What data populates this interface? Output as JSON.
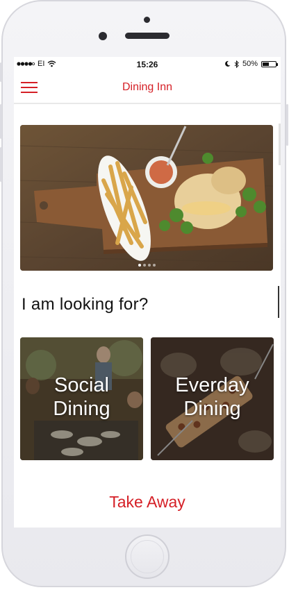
{
  "status_bar": {
    "carrier": "EI",
    "time": "15:26",
    "battery": "50%",
    "battery_level": 0.5
  },
  "navbar": {
    "title": "Dining Inn",
    "menu_icon": "hamburger-menu-icon"
  },
  "carousel": {
    "image": "sandwich-and-fries-on-wooden-board",
    "slide_count": 4,
    "active_slide": 1
  },
  "main": {
    "heading": "I am looking for?",
    "options": [
      {
        "label_line1": "Social",
        "label_line2": "Dining",
        "image": "outdoor-group-meal"
      },
      {
        "label_line1": "Everday",
        "label_line2": "Dining",
        "image": "table-of-dishes"
      }
    ],
    "takeaway_label": "Take Away"
  },
  "colors": {
    "accent": "#d51f26",
    "text": "#111111",
    "background": "#ffffff"
  }
}
